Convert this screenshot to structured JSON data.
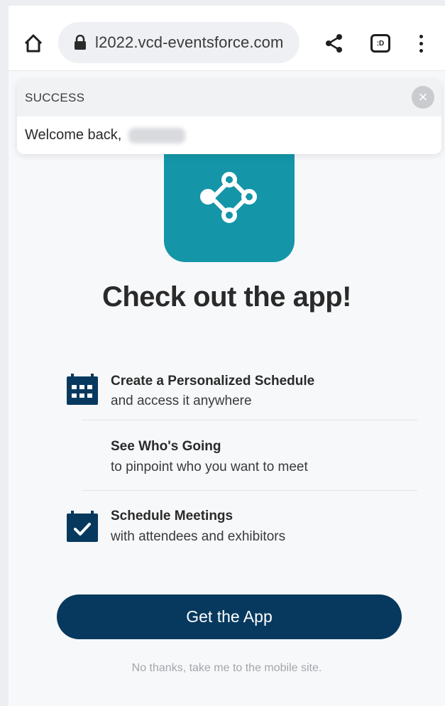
{
  "browser": {
    "url": "l2022.vcd-eventsforce.com",
    "tab_count": ":D"
  },
  "toast": {
    "title": "SUCCESS",
    "close_glyph": "×",
    "message": "Welcome back,"
  },
  "headline": "Check out the app!",
  "features": [
    {
      "title": "Create a Personalized Schedule",
      "subtitle": "and access it anywhere",
      "icon": "calendar-icon"
    },
    {
      "title": "See Who's Going",
      "subtitle": "to pinpoint who you want to meet",
      "icon": ""
    },
    {
      "title": "Schedule Meetings",
      "subtitle": "with attendees and exhibitors",
      "icon": "calendar-check-icon"
    }
  ],
  "cta": {
    "label": "Get the App"
  },
  "skip": {
    "label": "No thanks, take me to the mobile site."
  },
  "colors": {
    "brand_teal": "#1495a8",
    "navy": "#07395e"
  }
}
